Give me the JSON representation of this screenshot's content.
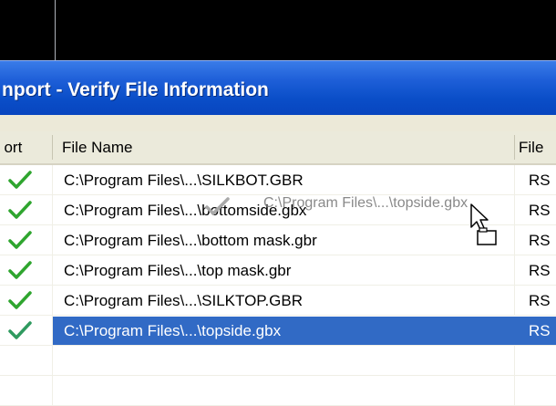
{
  "window": {
    "title": "nport - Verify File Information"
  },
  "table": {
    "columns": {
      "import": "port",
      "file_name": "File Name",
      "format": "File"
    },
    "rows": [
      {
        "checked": true,
        "file": "C:\\Program Files\\...\\SILKBOT.GBR",
        "format": "RS",
        "selected": false
      },
      {
        "checked": true,
        "file": "C:\\Program Files\\...\\bottomside.gbx",
        "format": "RS",
        "selected": false
      },
      {
        "checked": true,
        "file": "C:\\Program Files\\...\\bottom mask.gbr",
        "format": "RS",
        "selected": false
      },
      {
        "checked": true,
        "file": "C:\\Program Files\\...\\top mask.gbr",
        "format": "RS",
        "selected": false
      },
      {
        "checked": true,
        "file": "C:\\Program Files\\...\\SILKTOP.GBR",
        "format": "RS",
        "selected": false
      },
      {
        "checked": true,
        "file": "C:\\Program Files\\...\\topside.gbx",
        "format": "RS",
        "selected": true
      }
    ]
  },
  "drag": {
    "ghost_text": "C:\\Program Files\\...\\topside.gbx",
    "cursor_icon": "drag-copy-cursor-icon"
  },
  "colors": {
    "titlebar": "#0a4ec8",
    "selection": "#316ac5",
    "check": "#2fa52f"
  }
}
